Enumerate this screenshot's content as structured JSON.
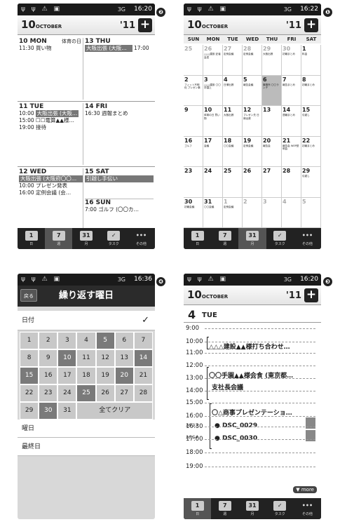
{
  "badges": [
    "❷",
    "❶",
    "❹",
    "❸"
  ],
  "status": {
    "p1_time": "16:20",
    "p2_time": "16:22",
    "p3_time": "16:36",
    "p4_time": "16:20",
    "icons": "ψ ψ ⚠ ▣",
    "signal": "3G"
  },
  "header": {
    "day": "10",
    "month": "OCTOBER",
    "year": "'11",
    "plus": "+"
  },
  "tabs": [
    {
      "icon": "1",
      "label": "日"
    },
    {
      "icon": "7",
      "label": "週"
    },
    {
      "icon": "31",
      "label": "月"
    },
    {
      "icon": "✓",
      "label": "タスク"
    },
    {
      "icon": "•••",
      "label": "その他"
    }
  ],
  "week": {
    "c1": {
      "h": "10 MON",
      "holiday": "体育の日",
      "l1": "11:30 買い物"
    },
    "c2": {
      "h": "13 THU",
      "ev": "大阪出張 (大阪…",
      "l1": "17:00"
    },
    "c3": {
      "h": "11 TUE",
      "l1": "10:00",
      "ev": "大阪出張 (大阪…",
      "l2": "15:00 ☐☐電算▲▲様…",
      "l3": "19:00 接待"
    },
    "c4": {
      "h": "14 FRI",
      "l1": "16:30 週報まとめ"
    },
    "c5": {
      "h": "12 WED",
      "ev": "大阪出張 (大阪府〇〇…",
      "l1": "10:00 プレゼン発表",
      "l2": "16:00 定例会議 (会…"
    },
    "c6": {
      "h": "15 SAT",
      "ev": "引越し手伝い"
    },
    "c7": {
      "h": "16 SUN",
      "l1": "7:00 ゴルフ (〇〇カ…"
    }
  },
  "month": {
    "dow": [
      "SUN",
      "MON",
      "TUE",
      "WED",
      "THU",
      "FRI",
      "SAT"
    ],
    "days": [
      [
        "25",
        "26",
        "27",
        "28",
        "29",
        "30",
        "1"
      ],
      [
        "2",
        "3",
        "4",
        "5",
        "6",
        "7",
        "8"
      ],
      [
        "9",
        "10",
        "11",
        "12",
        "13",
        "14",
        "15"
      ],
      [
        "16",
        "17",
        "18",
        "19",
        "20",
        "21",
        "22"
      ],
      [
        "23",
        "24",
        "25",
        "26",
        "27",
        "28",
        "29"
      ],
      [
        "30",
        "31",
        "1",
        "2",
        "3",
        "4",
        "5"
      ]
    ],
    "notes": {
      "w0": [
        "",
        "△△△建設 記者会見",
        "定例会議",
        "定例会議",
        "大阪出張",
        "初報まとめ",
        "料金"
      ],
      "w1": [
        "フィット不明化 プレゼン事",
        "△△△建設 〇〇手園上",
        "日帰出張",
        "報告会議",
        "事務所 〇〇ランチ",
        "報告まとめ",
        "初報まとめ"
      ],
      "w2": [
        "",
        "体育の日 買い物",
        "大阪出張",
        "プレゼン先 日帰出張",
        "",
        "週報まとめ",
        "引越し"
      ],
      "w3": [
        "ゴルフ",
        "会議",
        "〇〇会議",
        "定例会議",
        "報告会",
        "報告会 WEP説明会",
        "初報まとめ"
      ],
      "w4": [
        "",
        "",
        "",
        "",
        "",
        "",
        "引越し"
      ],
      "w5": [
        "初報会議",
        "〇〇会議",
        "定例会議",
        "",
        "",
        "",
        ""
      ]
    }
  },
  "repeat": {
    "back": "戻る",
    "title": "繰り返す曜日",
    "date_label": "日付",
    "check": "✓",
    "days": [
      "1",
      "2",
      "3",
      "4",
      "5",
      "6",
      "7",
      "8",
      "9",
      "10",
      "11",
      "12",
      "13",
      "14",
      "15",
      "16",
      "17",
      "18",
      "19",
      "20",
      "21",
      "22",
      "23",
      "24",
      "25",
      "26",
      "27",
      "28",
      "29",
      "30",
      "31"
    ],
    "clear": "全てクリア",
    "weekday": "曜日",
    "last": "最終日"
  },
  "day": {
    "date": "4",
    "dow": "TUE",
    "times": [
      "9:00",
      "10:00",
      "11:00",
      "12:00",
      "13:00",
      "14:00",
      "15:00",
      "16:00",
      "16:30",
      "17:00",
      "18:00",
      "19:00"
    ],
    "ev1": "△△△建設▲▲様打ち合わせ…",
    "ev2": "〇〇手園▲▲様会食 (東京都…",
    "ev3": "支社長会議",
    "ev4": "〇△商事プレゼンテーショ…",
    "ev5": "● DSC_0029",
    "ev6": "● DSC_0030",
    "t1": "16:13",
    "t2": "16:14",
    "more": "▼ more"
  }
}
